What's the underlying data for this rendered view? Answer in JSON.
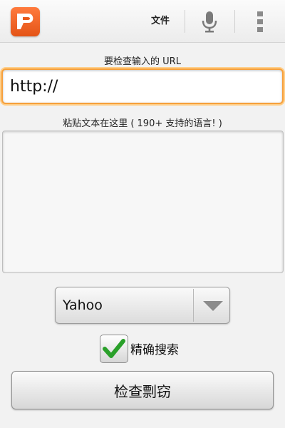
{
  "action_bar": {
    "app_icon": "plagiarism-app-logo-icon",
    "file_label": "文件",
    "mic_icon": "microphone-icon",
    "overflow_icon": "overflow-menu-icon"
  },
  "url_section": {
    "label": "要检查输入的 URL",
    "value": "http://"
  },
  "text_section": {
    "label": "粘贴文本在这里 ( 190+ 支持的语言! )",
    "value": ""
  },
  "search_engine": {
    "selected": "Yahoo"
  },
  "exact_search": {
    "label": "精确搜索",
    "checked": true
  },
  "check_button": {
    "label": "检查剽窃"
  },
  "colors": {
    "accent": "#f6a03c",
    "logo": "#e8591b",
    "check": "#2aa02a"
  }
}
